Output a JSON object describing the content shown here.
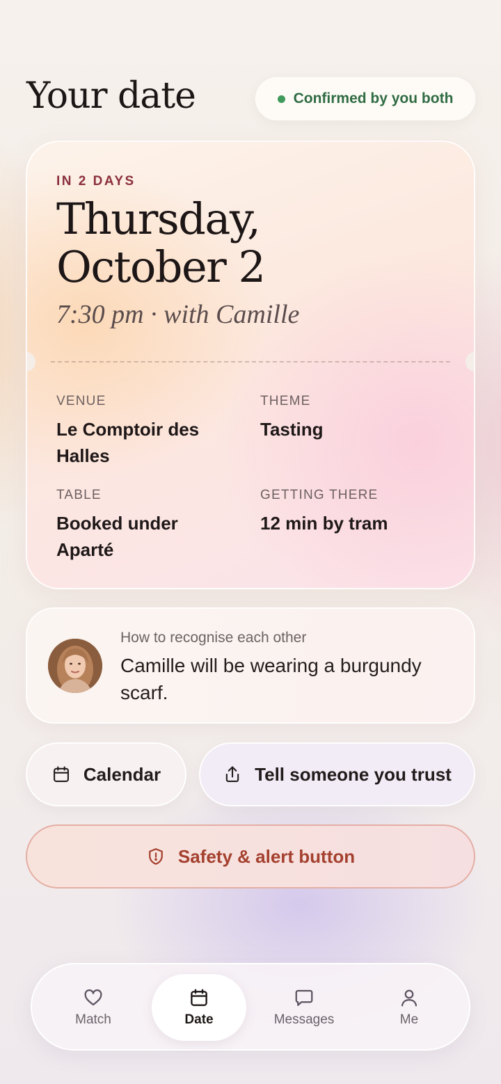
{
  "header": {
    "title": "Your date",
    "status": "Confirmed by you both",
    "status_color": "#3f9a5b"
  },
  "date_card": {
    "eyebrow": "IN 2 DAYS",
    "date": "Thursday, October 2",
    "subtitle": "7:30 pm · with Camille",
    "details": {
      "venue": {
        "label": "VENUE",
        "value": "Le Comptoir des Halles"
      },
      "theme": {
        "label": "THEME",
        "value": "Tasting"
      },
      "table": {
        "label": "TABLE",
        "value": "Booked under Aparté"
      },
      "getting_there": {
        "label": "GETTING THERE",
        "value": "12 min by tram"
      }
    }
  },
  "recognise": {
    "label": "How to recognise each other",
    "text": "Camille will be wearing a burgundy scarf.",
    "avatar_icon": "profile-photo"
  },
  "actions": {
    "calendar": {
      "label": "Calendar",
      "icon": "calendar-icon"
    },
    "share": {
      "label": "Tell someone you trust",
      "icon": "share-icon"
    },
    "safety": {
      "label": "Safety & alert button",
      "icon": "shield-alert-icon",
      "color": "#a4402e"
    }
  },
  "tabbar": {
    "tabs": [
      {
        "label": "Match",
        "icon": "heart-icon",
        "active": false
      },
      {
        "label": "Date",
        "icon": "calendar-icon",
        "active": true
      },
      {
        "label": "Messages",
        "icon": "chat-bubble-icon",
        "active": false
      },
      {
        "label": "Me",
        "icon": "person-icon",
        "active": false
      }
    ]
  }
}
